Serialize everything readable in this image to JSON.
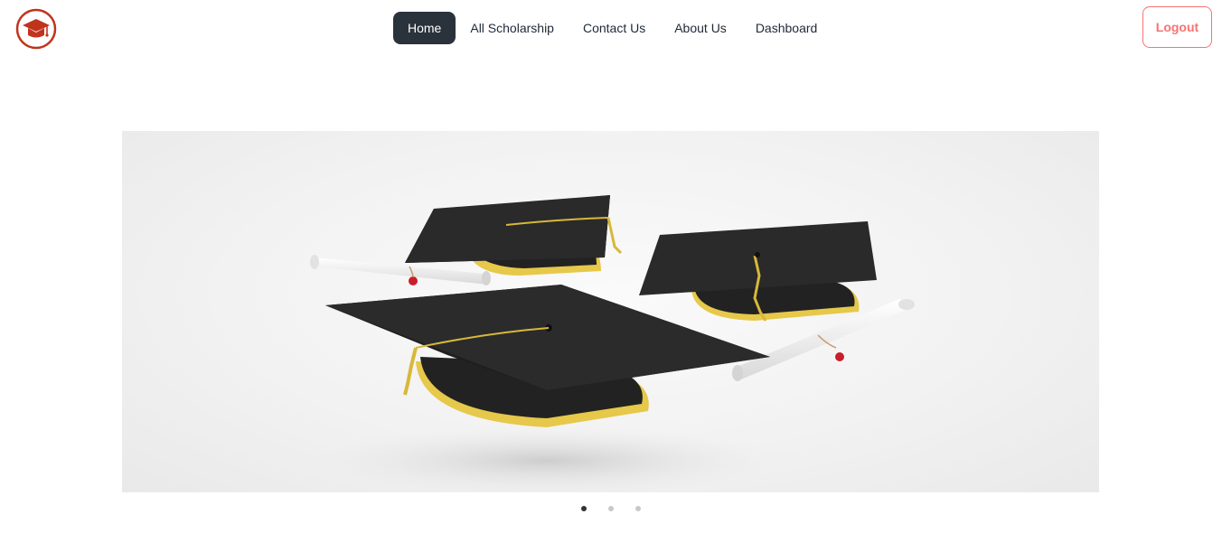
{
  "brand": {
    "logo_icon": "graduation-cap-icon",
    "logo_color": "#c0341d"
  },
  "nav": {
    "items": [
      {
        "label": "Home",
        "active": true
      },
      {
        "label": "All Scholarship",
        "active": false
      },
      {
        "label": "Contact Us",
        "active": false
      },
      {
        "label": "About Us",
        "active": false
      },
      {
        "label": "Dashboard",
        "active": false
      }
    ]
  },
  "logout": {
    "label": "Logout",
    "color": "#f87272"
  },
  "carousel": {
    "slide_image": "graduation-caps-and-diplomas",
    "slide_count": 3,
    "active_index": 0
  }
}
